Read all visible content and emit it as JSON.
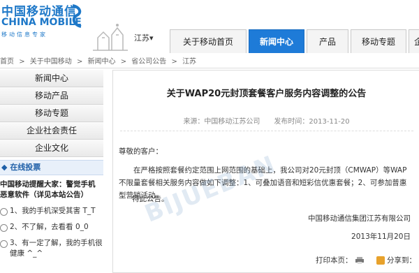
{
  "header": {
    "logo_cn": "中国移动通信",
    "logo_en": "CHINA MOBILE",
    "logo_slogan": "移动信息专家",
    "province": "江苏▾"
  },
  "nav": {
    "items": [
      "关于移动首页",
      "新闻中心",
      "产品",
      "移动专题",
      "企业"
    ],
    "active_index": 1,
    "accent_color": "#1e7bd8"
  },
  "breadcrumb": {
    "items": [
      "首页",
      ">",
      "关于中国移动",
      ">",
      "新闻中心",
      ">",
      "省公司公告",
      ">",
      "江苏"
    ]
  },
  "sidebar": {
    "items": [
      "新闻中心",
      "移动产品",
      "移动专题",
      "企业社会责任",
      "企业文化"
    ],
    "vote": {
      "header": "在线投票",
      "question": "中国移动提醒大家：警觉手机恶意软件（详见本站公告）",
      "options": [
        "1、我的手机深受其害 T_T",
        "2、不了解，去看看 0_0",
        "3、有一定了解，我的手机很健康 ^_^"
      ]
    }
  },
  "article": {
    "title": "关于WAP20元封顶套餐客户服务内容调整的公告",
    "meta": "来源：中国移动江苏公司　　发布时间：2013-11-20",
    "greeting": "尊敬的客户：",
    "body": "在严格按照套餐约定范围上网范围的基础上，我公司对20元封顶（CMWAP）等WAP不限量套餐相关服务内容做如下调整：1、可叠加语音和短彩信优惠套餐；2、可参加普惠型营销活动。",
    "notice": "特此公告。",
    "signer": "中国移动通信集团江苏有限公司",
    "date": "2013年11月20日",
    "print_label": "打印本页：",
    "share_label": "分享到："
  },
  "watermark": "BIJUEBAN"
}
